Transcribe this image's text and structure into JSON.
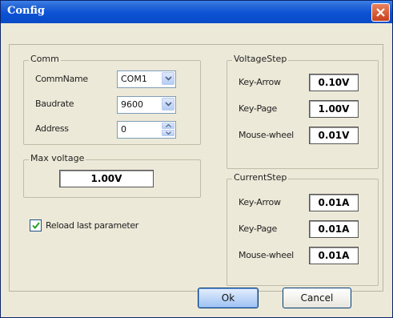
{
  "window": {
    "title": "Config"
  },
  "comm": {
    "legend": "Comm",
    "comm_name_label": "CommName",
    "comm_name_value": "COM1",
    "baudrate_label": "Baudrate",
    "baudrate_value": "9600",
    "address_label": "Address",
    "address_value": "0"
  },
  "max_voltage": {
    "legend": "Max voltage",
    "value": "1.00V"
  },
  "reload": {
    "label": "Reload last parameter",
    "checked": true
  },
  "voltage_step": {
    "legend": "VoltageStep",
    "rows": [
      {
        "label": "Key-Arrow",
        "value": "0.10V"
      },
      {
        "label": "Key-Page",
        "value": "1.00V"
      },
      {
        "label": "Mouse-wheel",
        "value": "0.01V"
      }
    ]
  },
  "current_step": {
    "legend": "CurrentStep",
    "rows": [
      {
        "label": "Key-Arrow",
        "value": "0.01A"
      },
      {
        "label": "Key-Page",
        "value": "0.01A"
      },
      {
        "label": "Mouse-wheel",
        "value": "0.01A"
      }
    ]
  },
  "buttons": {
    "ok": "Ok",
    "cancel": "Cancel"
  },
  "icons": {
    "close": "close-icon",
    "dropdown": "chevron-down-icon",
    "spin_up": "spin-up-icon",
    "spin_down": "spin-down-icon",
    "check": "checkmark-icon"
  },
  "colors": {
    "title_bar": "#0b52d4",
    "dialog_bg": "#ece9d8",
    "close_button": "#d9542e"
  }
}
